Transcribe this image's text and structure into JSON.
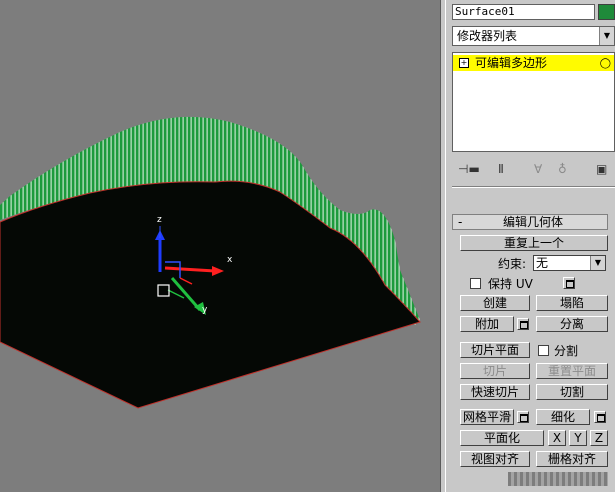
{
  "viewport": {
    "axis_labels": {
      "z": "z",
      "x": "x",
      "y": "y"
    },
    "surface_color": "#1a9a3a",
    "fill_color": "#050805",
    "edge_color": "#c0302a"
  },
  "panel": {
    "object_name": "Surface01",
    "object_color": "#1f8a3a",
    "modifier_list": "修改器列表",
    "stack_item": "可编辑多边形",
    "stack_item_color": "#fffb00",
    "rollout_title": "编辑几何体",
    "repeat_last": "重复上一个",
    "constraint_label": "约束:",
    "constraint_value": "无",
    "preserve_uv": "保持 UV",
    "create": "创建",
    "collapse": "塌陷",
    "attach": "附加",
    "detach": "分离",
    "slice_plane": "切片平面",
    "split": "分割",
    "slice": "切片",
    "reset_plane": "重置平面",
    "quick_slice": "快速切片",
    "cut": "切割",
    "mesh_smooth": "网格平滑",
    "tessellate": "细化",
    "make_planar": "平面化",
    "x_btn": "X",
    "y_btn": "Y",
    "z_btn": "Z",
    "view_align": "视图对齐",
    "grid_align": "栅格对齐"
  }
}
